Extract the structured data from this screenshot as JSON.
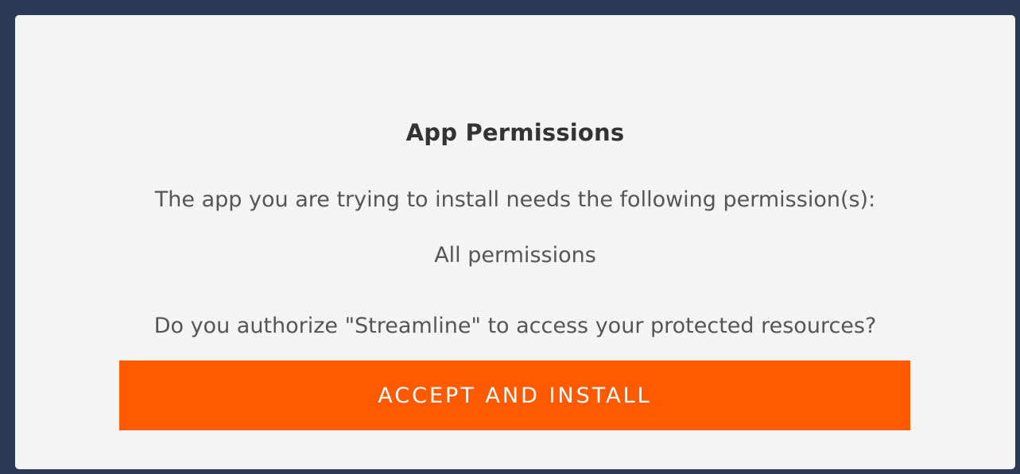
{
  "dialog": {
    "title": "App Permissions",
    "intro": "The app you are trying to install needs the following permission(s):",
    "permissions": "All permissions",
    "question": "Do you authorize \"Streamline\" to access your protected resources?",
    "accept_label": "ACCEPT AND INSTALL"
  },
  "colors": {
    "frame": "#2b3a55",
    "dialog_bg": "#f4f4f4",
    "accent": "#ff5a00"
  }
}
